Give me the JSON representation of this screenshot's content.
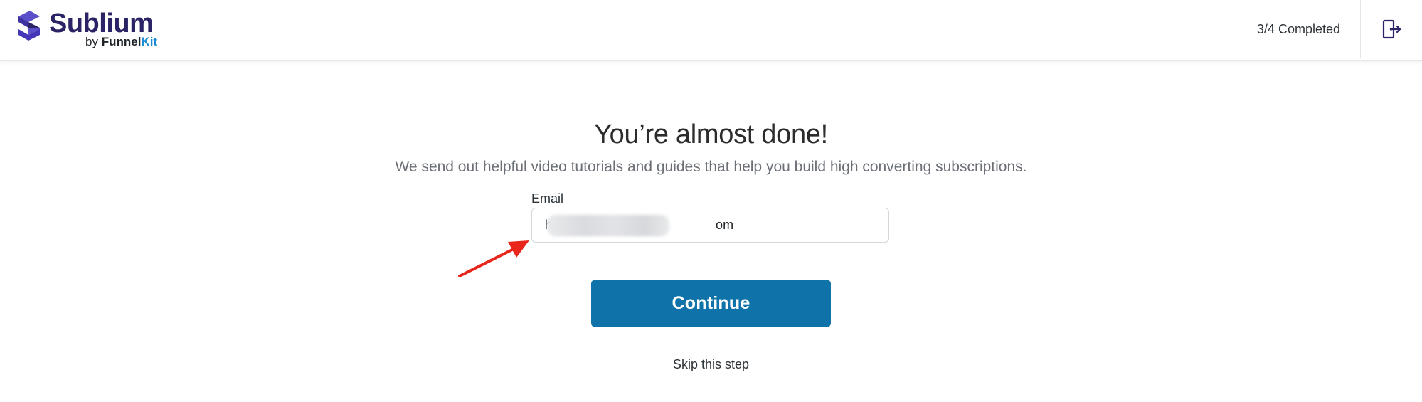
{
  "header": {
    "logo": {
      "name": "Sublium",
      "by": "by",
      "brand_part1": "Funnel",
      "brand_part2": "Kit"
    },
    "progress_text": "3/4 Completed",
    "exit_icon": "exit-door-icon"
  },
  "main": {
    "title": "You’re almost done!",
    "subtitle": "We send out helpful video tutorials and guides that help you build high converting subscriptions.",
    "email_label": "Email",
    "email_value": "h                                              om",
    "continue_label": "Continue",
    "skip_label": "Skip this step"
  },
  "colors": {
    "brand_primary": "#2a2466",
    "brand_accent": "#1a8dd6",
    "button_bg": "#0f72a8",
    "annotation_arrow": "#e8261c"
  }
}
